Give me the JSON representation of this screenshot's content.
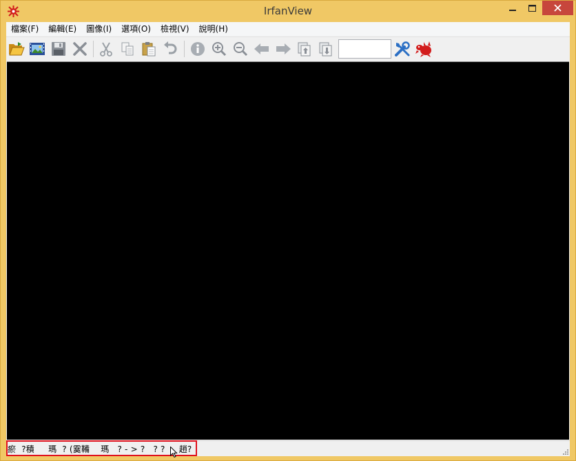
{
  "window": {
    "title": "IrfanView"
  },
  "menu": {
    "items": [
      "檔案(F)",
      "編輯(E)",
      "圖像(I)",
      "選項(O)",
      "檢視(V)",
      "說明(H)"
    ]
  },
  "toolbar": {
    "icons": [
      "open-folder-icon",
      "slideshow-icon",
      "save-icon",
      "delete-icon",
      "cut-icon",
      "copy-icon",
      "paste-icon",
      "undo-icon",
      "info-icon",
      "zoom-in-icon",
      "zoom-out-icon",
      "previous-icon",
      "next-icon",
      "page-up-icon",
      "page-down-icon",
      "settings-icon",
      "irfanview-logo-icon"
    ],
    "zoom_value": ""
  },
  "status": {
    "text": "瘀  ?積     瑪  ? (霙鞴    瑪   ? - > ?   ? ?     趙?"
  },
  "colors": {
    "titlebar": "#f0c865",
    "close_button": "#c7463c",
    "canvas": "#000000",
    "highlight": "#e0101c"
  }
}
